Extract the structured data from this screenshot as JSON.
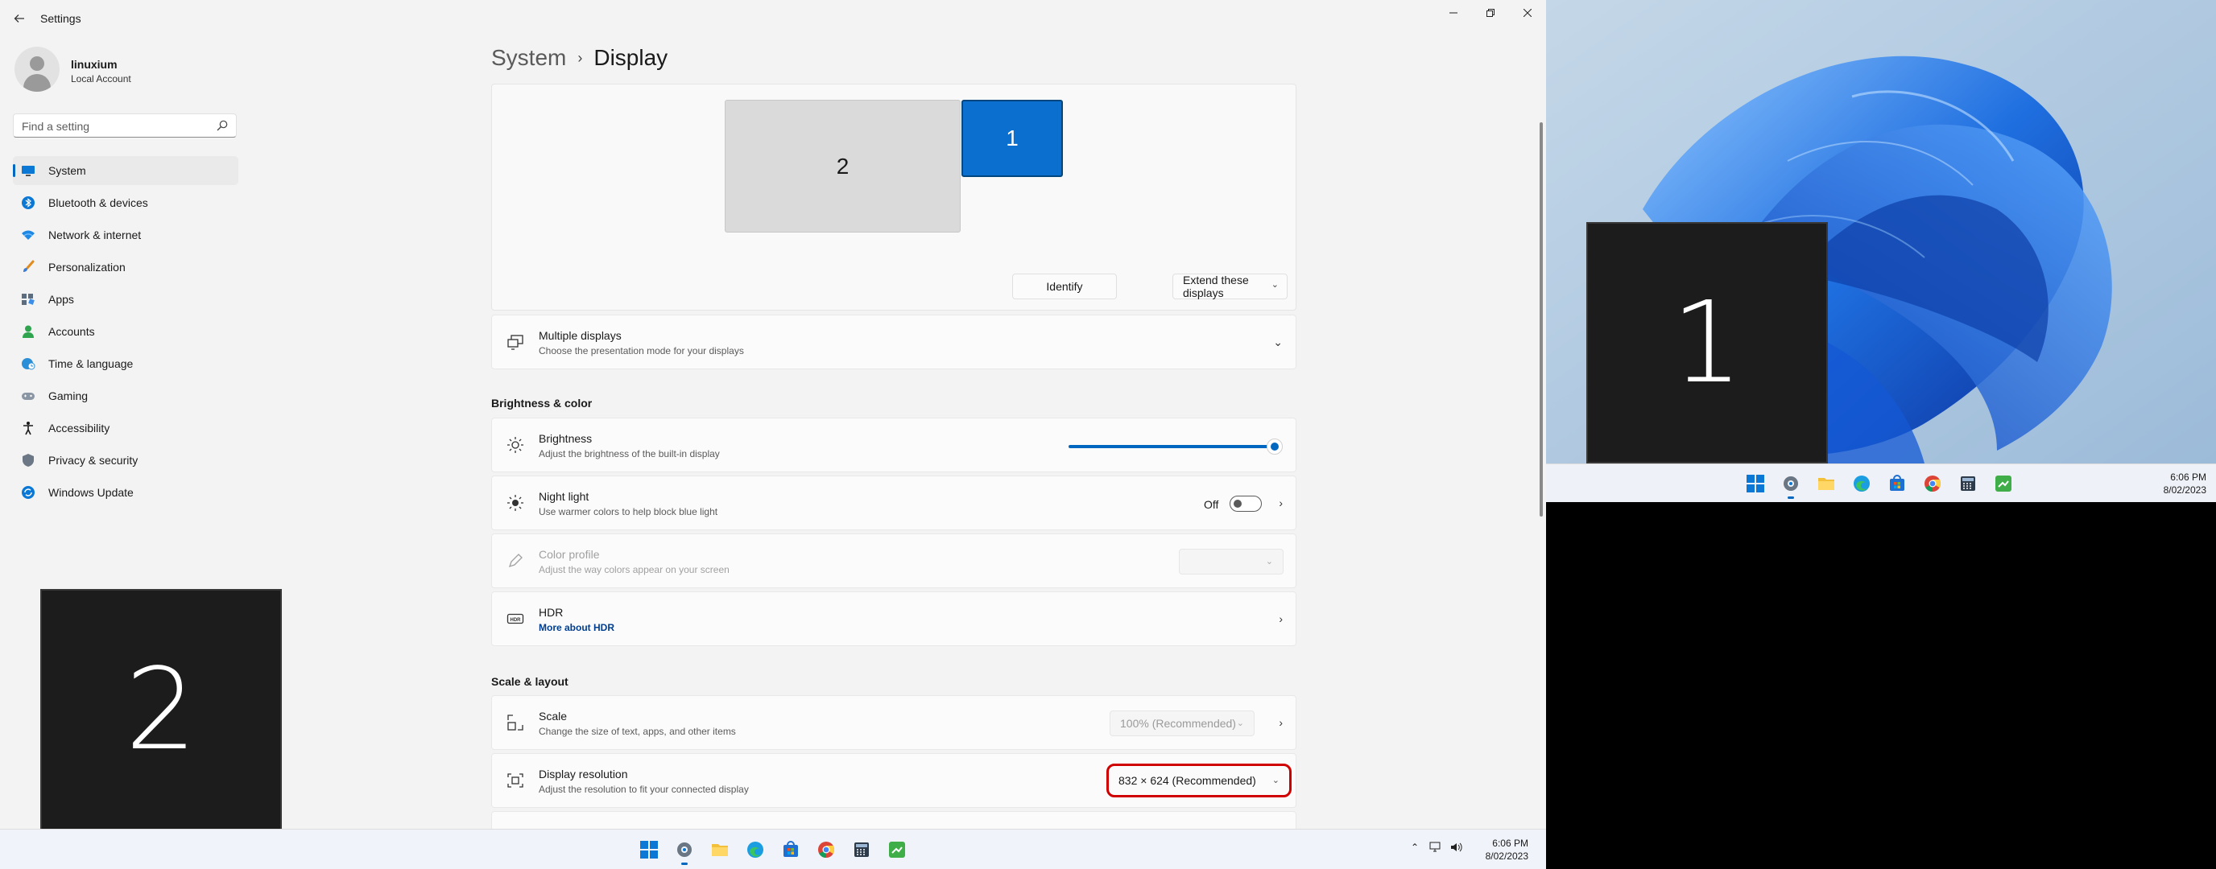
{
  "window": {
    "title": "Settings",
    "controls": [
      "Minimize",
      "Maximize",
      "Close"
    ]
  },
  "user": {
    "name": "linuxium",
    "account_type": "Local Account"
  },
  "search": {
    "placeholder": "Find a setting"
  },
  "nav": {
    "items": [
      {
        "label": "System",
        "icon": "system-icon",
        "active": true
      },
      {
        "label": "Bluetooth & devices",
        "icon": "bluetooth-icon"
      },
      {
        "label": "Network & internet",
        "icon": "wifi-icon"
      },
      {
        "label": "Personalization",
        "icon": "brush-icon"
      },
      {
        "label": "Apps",
        "icon": "apps-icon"
      },
      {
        "label": "Accounts",
        "icon": "person-icon"
      },
      {
        "label": "Time & language",
        "icon": "globe-clock-icon"
      },
      {
        "label": "Gaming",
        "icon": "gamepad-icon"
      },
      {
        "label": "Accessibility",
        "icon": "accessibility-icon"
      },
      {
        "label": "Privacy & security",
        "icon": "shield-icon"
      },
      {
        "label": "Windows Update",
        "icon": "update-icon"
      }
    ]
  },
  "breadcrumb": {
    "parent": "System",
    "separator": "›",
    "current": "Display"
  },
  "arrange": {
    "monitor_2": "2",
    "monitor_1": "1",
    "identify_label": "Identify",
    "mode_label": "Extend these displays"
  },
  "multiple_displays": {
    "title": "Multiple displays",
    "subtitle": "Choose the presentation mode for your displays"
  },
  "brightness_color": {
    "heading": "Brightness & color",
    "brightness": {
      "title": "Brightness",
      "subtitle": "Adjust the brightness of the built-in display",
      "level_percent": 100
    },
    "night_light": {
      "title": "Night light",
      "subtitle": "Use warmer colors to help block blue light",
      "state": "Off"
    },
    "color_profile": {
      "title": "Color profile",
      "subtitle": "Adjust the way colors appear on your screen",
      "value": ""
    },
    "hdr": {
      "title": "HDR",
      "link": "More about HDR"
    }
  },
  "scale_layout": {
    "heading": "Scale & layout",
    "scale": {
      "title": "Scale",
      "subtitle": "Change the size of text, apps, and other items",
      "value": "100% (Recommended)"
    },
    "resolution": {
      "title": "Display resolution",
      "subtitle": "Adjust the resolution to fit your connected display",
      "value": "832 × 624 (Recommended)"
    }
  },
  "identify_overlay": {
    "left_number": "2",
    "right_number": "1"
  },
  "taskbar_left": {
    "time": "6:06 PM",
    "date": "8/02/2023"
  },
  "taskbar_right": {
    "time": "6:06 PM",
    "date": "8/02/2023"
  },
  "colors": {
    "accent": "#0067c0",
    "highlight_outline": "#d00000",
    "monitor_selected": "#0a6fcf"
  }
}
